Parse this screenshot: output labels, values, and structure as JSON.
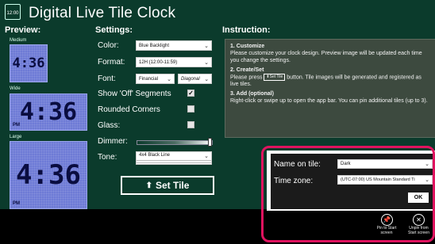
{
  "app": {
    "title": "Digital Live Tile Clock",
    "icon_text": "12:00",
    "icon_name": "clock-tile-icon"
  },
  "preview": {
    "heading": "Preview:",
    "medium_label": "Medium",
    "wide_label": "Wide",
    "large_label": "Large",
    "time": "4:36",
    "ampm": "PM"
  },
  "settings": {
    "heading": "Settings:",
    "color_label": "Color:",
    "color_value": "Blue Backlight",
    "format_label": "Format:",
    "format_value": "12H (12:00-11:59)",
    "font_label": "Font:",
    "font_value": "Financial",
    "font_style_value": "Diagonal",
    "show_off_label": "Show 'Off' Segments",
    "show_off_checked": true,
    "rounded_label": "Rounded Corners",
    "rounded_checked": false,
    "glass_label": "Glass:",
    "glass_checked": false,
    "dimmer_label": "Dimmer:",
    "tone_label": "Tone:",
    "tone_value": "4x4 Black Line",
    "set_tile_label": "Set Tile"
  },
  "instruction": {
    "heading": "Instruction:",
    "s1_title": "1. Customize",
    "s1_text": "Please customize your clock design. Preview image will be updated each time you change the settings.",
    "s2_title": "2. Create/Set",
    "s2_text_a": "Please press",
    "s2_btn": "Set Tile",
    "s2_text_b": "button. Tile images will be generated and registered as live tiles.",
    "s3_title": "3. Add (optional)",
    "s3_text": "Right-click or swipe up to open the app bar. You can pin additional tiles (up to 3)."
  },
  "flyout": {
    "name_label": "Name on tile:",
    "name_value": "Dark",
    "tz_label": "Time zone:",
    "tz_value": "(UTC-07:00) US Mountain Standard Ti",
    "ok_label": "OK"
  },
  "appbar": {
    "pin_label_1": "Pin to Start",
    "pin_label_2": "screen",
    "unpin_label_1": "Unpin from",
    "unpin_label_2": "Start screen"
  },
  "colors": {
    "background": "#0b3b2c",
    "lcd": "#6e7bd6",
    "highlight": "#e0135f"
  }
}
